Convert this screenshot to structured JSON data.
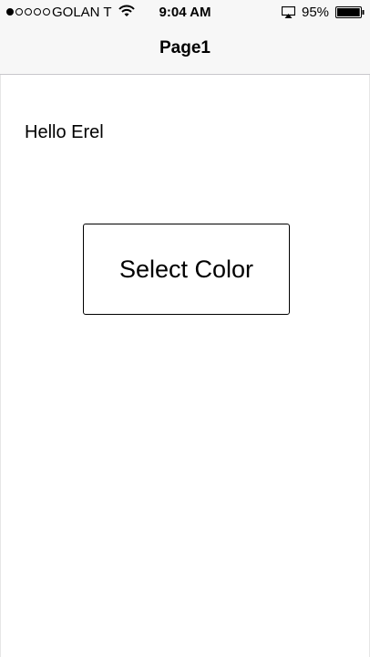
{
  "status_bar": {
    "signal_total": 5,
    "signal_filled": 1,
    "carrier": "GOLAN T",
    "time": "9:04 AM",
    "battery_percent": "95%",
    "battery_level": 0.95,
    "icons": [
      "wifi-icon",
      "airplay-icon",
      "battery-icon"
    ]
  },
  "nav": {
    "title": "Page1"
  },
  "main": {
    "greeting": "Hello Erel",
    "select_color_label": "Select Color"
  },
  "colors": {
    "background": "#ffffff",
    "chrome": "#f7f7f7",
    "text": "#000000"
  }
}
